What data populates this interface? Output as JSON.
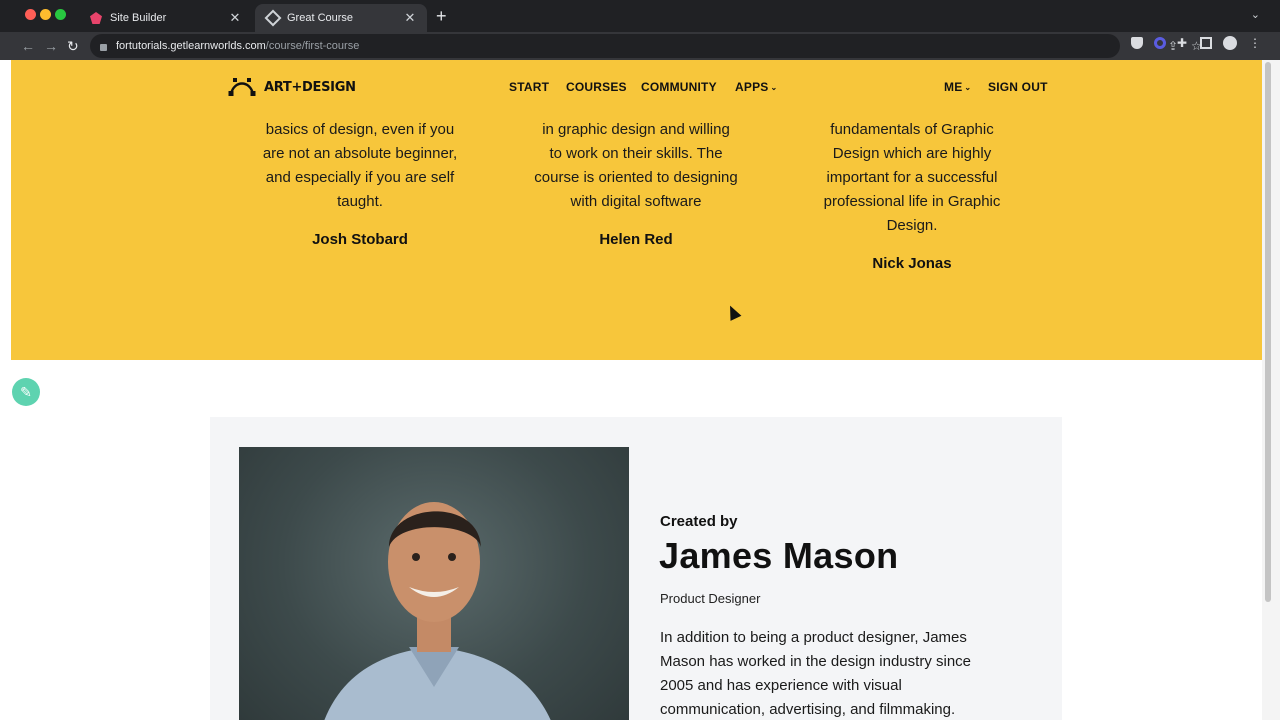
{
  "browser": {
    "tabs": [
      {
        "title": "Site Builder",
        "close": "✕"
      },
      {
        "title": "Great Course",
        "close": "✕"
      }
    ],
    "new_tab": "+",
    "tab_menu": "⌄",
    "url_host": "fortutorials.getlearnworlds.com",
    "url_path": "/course/first-course",
    "icons": {
      "back": "←",
      "forward": "→",
      "reload": "↻",
      "share": "⇪",
      "star": "☆",
      "puzzle": "✚",
      "kebab": "⋮"
    }
  },
  "site": {
    "logo_text": "ART+DESIGN",
    "nav": {
      "start": "START",
      "courses": "COURSES",
      "community": "COMMUNITY",
      "apps": "APPS",
      "me": "ME",
      "sign_out": "SIGN OUT",
      "caret": "⌄"
    },
    "accent_color": "#f7c63b",
    "edit_color": "#5ed3b0"
  },
  "testimonials": [
    {
      "lines": [
        "basics of design, even if you",
        "are not an absolute beginner,",
        "and especially if you are self",
        "taught."
      ],
      "author": "Josh Stobard"
    },
    {
      "lines": [
        "in graphic design and willing",
        "to work on their skills. The",
        "course is oriented to designing",
        "with digital software"
      ],
      "author": "Helen Red"
    },
    {
      "lines": [
        "fundamentals of Graphic",
        "Design which are highly",
        "important for a successful",
        "professional life in Graphic",
        "Design."
      ],
      "author": "Nick Jonas"
    }
  ],
  "edit_icon": "✎",
  "creator": {
    "label": "Created by",
    "name": "James Mason",
    "role": "Product Designer",
    "bio_lines": [
      "In addition to being a product designer, James",
      "Mason has worked in the design industry since",
      "2005 and has experience with visual",
      "communication, advertising, and filmmaking."
    ]
  }
}
